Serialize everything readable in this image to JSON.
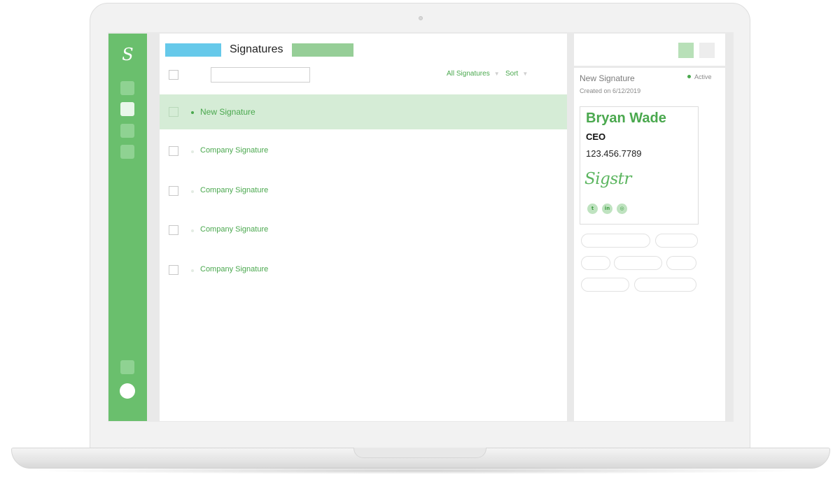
{
  "app": {
    "logo_letter": "S",
    "accent_color": "#6abf6d",
    "brand_text_color": "#4aa84e"
  },
  "header": {
    "title": "Signatures"
  },
  "toolbar": {
    "search_placeholder": "",
    "filter_label": "All Signatures",
    "sort_label": "Sort",
    "caret": "▼"
  },
  "signatures": [
    {
      "label": "New Signature",
      "selected": true
    },
    {
      "label": "Company Signature",
      "selected": false
    },
    {
      "label": "Company Signature",
      "selected": false
    },
    {
      "label": "Company Signature",
      "selected": false
    },
    {
      "label": "Company Signature",
      "selected": false
    }
  ],
  "detail": {
    "title": "New Signature",
    "status": "Active",
    "created": "Created on 6/12/2019",
    "card": {
      "name": "Bryan Wade",
      "role": "CEO",
      "phone": "123.456.7789",
      "logo_text": "Sigstr",
      "social": [
        {
          "icon": "twitter-icon",
          "glyph": "t"
        },
        {
          "icon": "linkedin-icon",
          "glyph": "in"
        },
        {
          "icon": "instagram-icon",
          "glyph": "◎"
        }
      ]
    }
  }
}
